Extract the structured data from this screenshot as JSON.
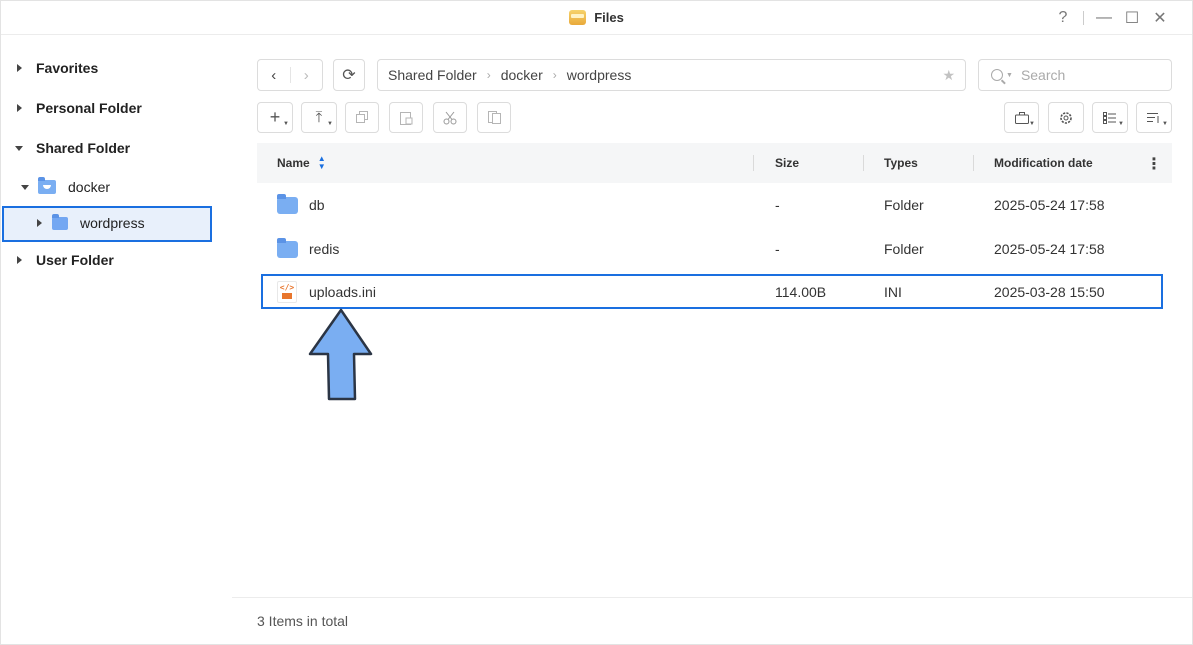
{
  "window": {
    "title": "Files",
    "help": "?",
    "minimize": "—",
    "maximize": "☐",
    "close": "✕"
  },
  "sidebar": {
    "favorites": "Favorites",
    "personal_folder": "Personal Folder",
    "shared_folder": "Shared Folder",
    "docker": "docker",
    "wordpress": "wordpress",
    "user_folder": "User Folder"
  },
  "toolbar": {
    "back": "‹",
    "forward": "›",
    "refresh": "⟳",
    "breadcrumb": [
      "Shared Folder",
      "docker",
      "wordpress"
    ],
    "search_placeholder": "Search",
    "new": "+",
    "upload": "⤒"
  },
  "table": {
    "headers": {
      "name": "Name",
      "size": "Size",
      "types": "Types",
      "modified": "Modification date"
    },
    "rows": [
      {
        "name": "db",
        "size": "-",
        "type": "Folder",
        "modified": "2025-05-24 17:58",
        "icon": "folder-icon"
      },
      {
        "name": "redis",
        "size": "-",
        "type": "Folder",
        "modified": "2025-05-24 17:58",
        "icon": "folder-icon"
      },
      {
        "name": "uploads.ini",
        "size": "114.00B",
        "type": "INI",
        "modified": "2025-03-28 15:50",
        "icon": "ini-file-icon"
      }
    ]
  },
  "status": {
    "total": "3 Items in total"
  },
  "colors": {
    "accent": "#1a6fe0",
    "folder": "#7aaef2",
    "arrow": "#7aaef2"
  }
}
